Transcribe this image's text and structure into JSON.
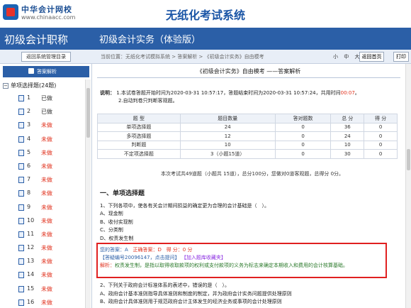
{
  "banner": {
    "logo_text": "中华会计网校",
    "logo_url": "www.chinaacc.com",
    "system_title": "无纸化考试系统"
  },
  "titlebar": {
    "level": "初级会计职称",
    "subject": "初级会计实务（体验版）"
  },
  "toolbar": {
    "return_label": "返回系统管理目录",
    "breadcrumb": "当前位置：无纸化考试模拟系统 > 答案解析 > 《初级会计实务》自由模考",
    "font_small": "小",
    "font_medium": "中",
    "font_large": "大",
    "home_label": "返回首页",
    "print_label": "打印"
  },
  "sidebar": {
    "header": "答案解析",
    "group_label": "单项选择题(24题)",
    "items": [
      {
        "num": "1",
        "status": "已做",
        "done": true
      },
      {
        "num": "2",
        "status": "已做",
        "done": true
      },
      {
        "num": "3",
        "status": "未做",
        "done": false
      },
      {
        "num": "4",
        "status": "未做",
        "done": false
      },
      {
        "num": "5",
        "status": "未做",
        "done": false
      },
      {
        "num": "6",
        "status": "未做",
        "done": false
      },
      {
        "num": "7",
        "status": "未做",
        "done": false
      },
      {
        "num": "8",
        "status": "未做",
        "done": false
      },
      {
        "num": "9",
        "status": "未做",
        "done": false
      },
      {
        "num": "10",
        "status": "未做",
        "done": false
      },
      {
        "num": "11",
        "status": "未做",
        "done": false
      },
      {
        "num": "12",
        "status": "未做",
        "done": false
      },
      {
        "num": "13",
        "status": "未做",
        "done": false
      },
      {
        "num": "14",
        "status": "未做",
        "done": false
      },
      {
        "num": "15",
        "status": "未做",
        "done": false
      },
      {
        "num": "16",
        "status": "未做",
        "done": false
      }
    ]
  },
  "main": {
    "exam_title": "《初级会计实务》自由模考 ——答案解析",
    "notes_label": "说明：",
    "note1_a": "1.本试卷答题开始时间为2020-03-31 10:57:17，答题结束时间为2020-03-31 10:57:24，共用时间",
    "note1_time": "00:07",
    "note1_b": "。",
    "note2": "2.自动判卷只判断客观题。",
    "table": {
      "headers": [
        "题 型",
        "题目数量",
        "答对题数",
        "总 分",
        "得 分"
      ],
      "rows": [
        [
          "单项选择题",
          "24",
          "0",
          "36",
          "0"
        ],
        [
          "多项选择题",
          "12",
          "0",
          "24",
          "0"
        ],
        [
          "判断题",
          "10",
          "0",
          "10",
          "0"
        ],
        [
          "不定项选择题",
          "3（小题15道）",
          "0",
          "30",
          "0"
        ]
      ]
    },
    "summary": "本次考试共49道题（小题共 15道），总分100分，您做对0道客观题，总得分 0分。",
    "section_title": "一、单项选择题",
    "q1": {
      "stem": "1、下列各项中，使各有关会计期间损益的确定更为合理的会计基础是（　）。",
      "options": [
        "A、现金制",
        "B、收付实现制",
        "C、分类制",
        "D、权责发生制"
      ]
    },
    "answer": {
      "your_answer": "您的答案：A",
      "correct_answer": "正确答案：D",
      "score": "得 分：0 分",
      "ask_link": "【答疑编号20096147，点击提问】",
      "fav_link": "【加入题库收藏夹】",
      "explain_label": "解析：",
      "explain_text": "权责发生制，是指以取得收取款项的权利或支付款项的义务为标志来确定本期收入和费用的会计核算基础。"
    },
    "q2": {
      "stem": "2、下列关于政府会计标准体系的表述中，错误的是（　）。",
      "options": [
        "A、政府会计基本准则指导具体准则和制度的制定，并为政府会计实务问题提供处理原则",
        "B、政府会计具体准则用于规范政府会计主体发生的经济业务或事项的会计处理原则"
      ]
    }
  },
  "colors": {
    "brand_blue": "#2b5fa7",
    "alert_red": "#e1321e",
    "explain_green": "#2b7a2b",
    "box_border": "#e02020"
  }
}
